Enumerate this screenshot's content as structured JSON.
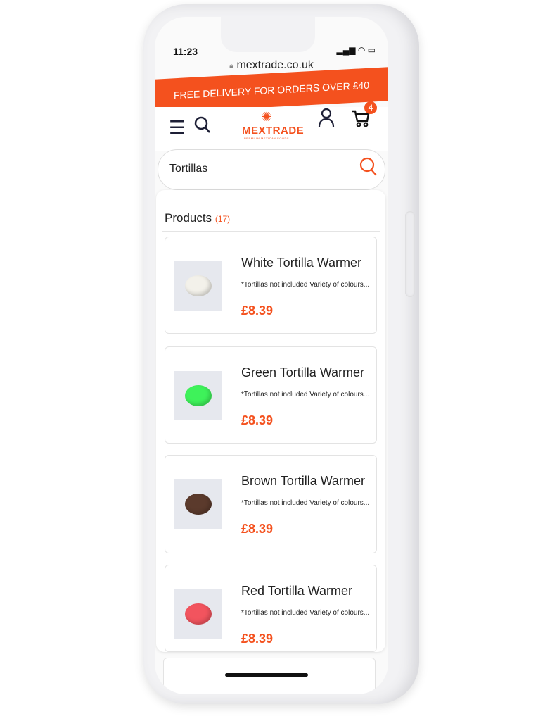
{
  "status": {
    "time": "11:23"
  },
  "browser": {
    "url": "mextrade.co.uk"
  },
  "banner": "FREE DELIVERY FOR ORDERS OVER £40",
  "header": {
    "logo_name": "MEXTRADE",
    "logo_sub": "PREMIUM MEXICAN FOODS",
    "cart_count": "4"
  },
  "search": {
    "value": "Tortillas"
  },
  "results": {
    "title": "Products",
    "count": "(17)",
    "items": [
      {
        "name": "White Tortilla Warmer",
        "desc": "*Tortillas not included Variety of colours...",
        "price": "£8.39",
        "color": "#f3f1ea"
      },
      {
        "name": "Green Tortilla Warmer",
        "desc": "*Tortillas not included Variety of colours...",
        "price": "£8.39",
        "color": "#3ef25a"
      },
      {
        "name": "Brown Tortilla Warmer",
        "desc": "*Tortillas not included Variety of colours...",
        "price": "£8.39",
        "color": "#5b3a2c"
      },
      {
        "name": "Red Tortilla Warmer",
        "desc": "*Tortillas not included Variety of colours...",
        "price": "£8.39",
        "color": "#f2545e"
      }
    ]
  },
  "colors": {
    "accent": "#f4511e"
  }
}
